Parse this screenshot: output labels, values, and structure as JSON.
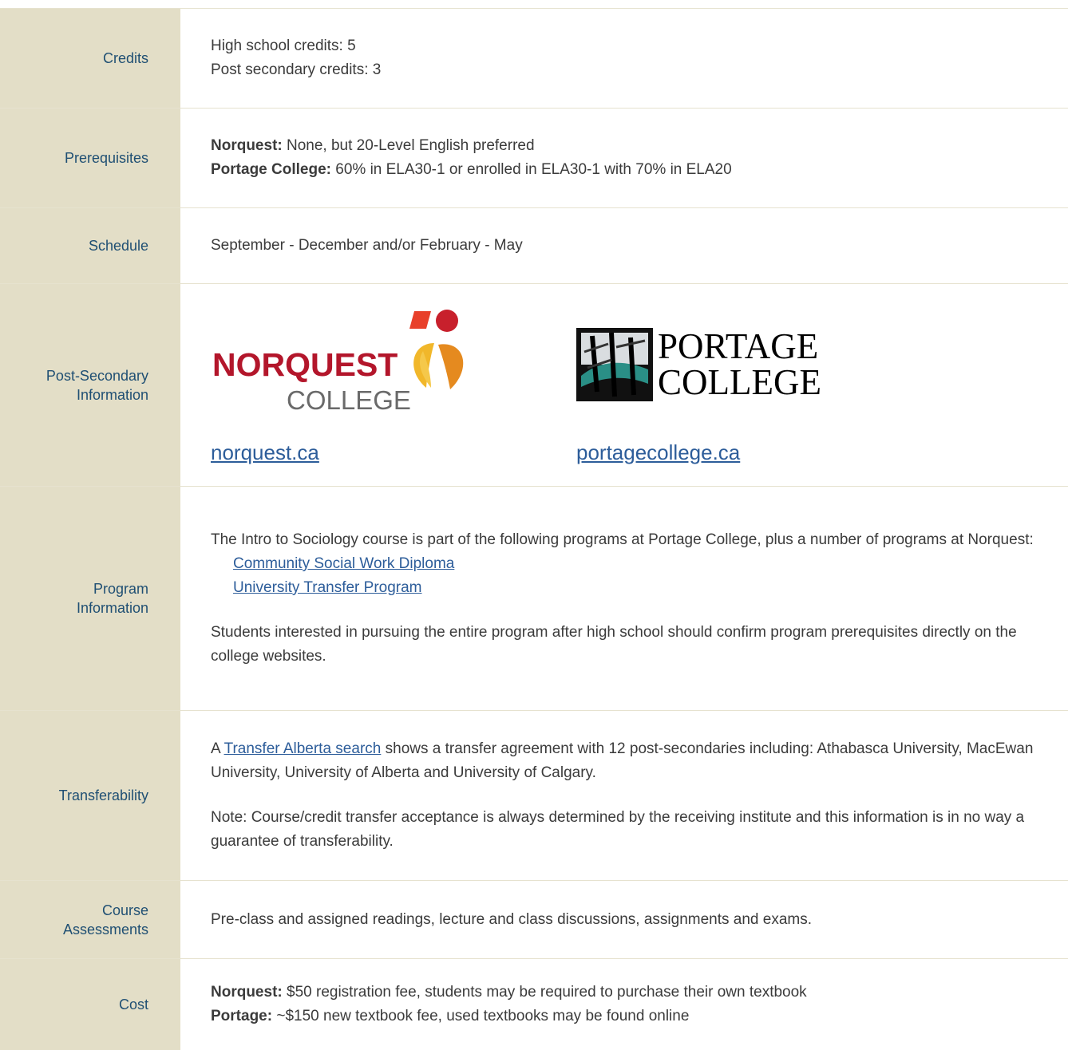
{
  "rows": {
    "credits": {
      "label": "Credits",
      "lines": [
        "High school credits: 5",
        "Post secondary credits: 3"
      ]
    },
    "prerequisites": {
      "label": "Prerequisites",
      "norquest_label": "Norquest:",
      "norquest_text": " None, but 20-Level English preferred",
      "portage_label": "Portage College:",
      "portage_text": " 60% in ELA30-1 or enrolled in ELA30-1 with 70% in ELA20"
    },
    "schedule": {
      "label": "Schedule",
      "text": "September - December and/or February - May"
    },
    "post_secondary": {
      "label_line1": "Post-Secondary",
      "label_line2": "Information",
      "norquest_logo_word": "NORQUEST",
      "norquest_logo_college": "COLLEGE",
      "norquest_link": "norquest.ca",
      "portage_logo_line1": "PORTAGE",
      "portage_logo_line2": "COLLEGE",
      "portage_link": "portagecollege.ca"
    },
    "program": {
      "label_line1": "Program",
      "label_line2": "Information",
      "intro": "The Intro to Sociology course is part of the following programs at Portage College, plus a number of programs at Norquest:",
      "links": [
        "Community Social Work Diploma",
        "University Transfer Program"
      ],
      "note": "Students interested in pursuing the entire program after high school should confirm program prerequisites directly on the college websites."
    },
    "transferability": {
      "label": "Transferability",
      "prefix": "A ",
      "link": "Transfer Alberta search",
      "suffix": " shows a transfer agreement with 12 post-secondaries including: Athabasca University, MacEwan University, University of Alberta and University of Calgary.",
      "note": "Note: Course/credit transfer acceptance is always determined by the receiving institute and this information is in no way a guarantee of transferability."
    },
    "assessments": {
      "label_line1": "Course",
      "label_line2": "Assessments",
      "text": "Pre-class and assigned readings, lecture and class discussions, assignments and exams."
    },
    "cost": {
      "label": "Cost",
      "norquest_label": "Norquest:",
      "norquest_text": " $50 registration fee, students may be required to purchase their own textbook",
      "portage_label": "Portage:",
      "portage_text": " ~$150 new textbook fee, used textbooks may be found online"
    }
  },
  "colors": {
    "label_bg": "#e3dec7",
    "label_text": "#1f4f73",
    "link": "#2d5d9a",
    "divider": "#e6e2cf"
  }
}
